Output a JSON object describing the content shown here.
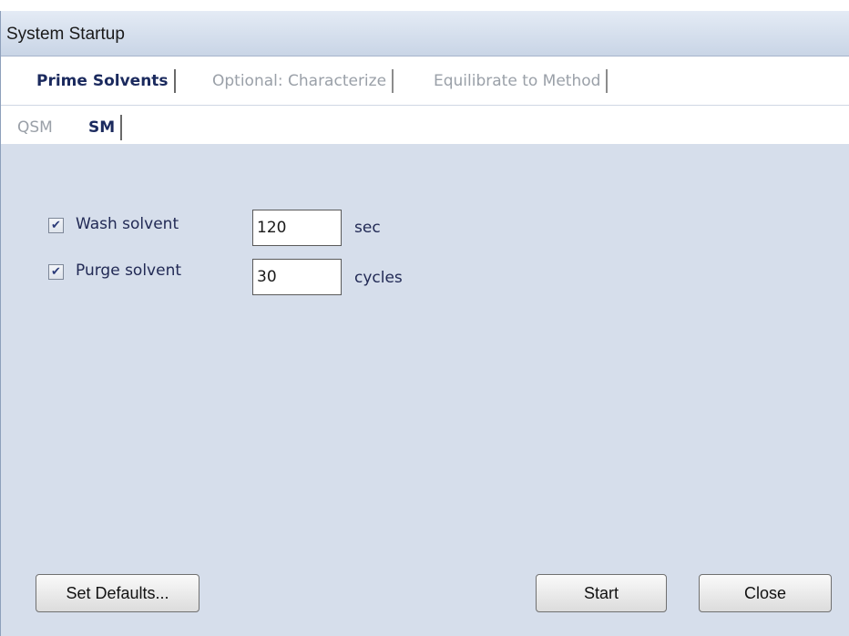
{
  "window": {
    "title": "System Startup"
  },
  "main_tabs": [
    {
      "label": "Prime Solvents",
      "active": true
    },
    {
      "label": "Optional: Characterize",
      "active": false
    },
    {
      "label": "Equilibrate to Method",
      "active": false
    }
  ],
  "sub_tabs": [
    {
      "label": "QSM",
      "active": false
    },
    {
      "label": "SM",
      "active": true
    }
  ],
  "options": {
    "wash": {
      "label": "Wash solvent",
      "checked": true,
      "value": "120",
      "unit": "sec"
    },
    "purge": {
      "label": "Purge solvent",
      "checked": true,
      "value": "30",
      "unit": "cycles"
    }
  },
  "checkmark": "✔",
  "buttons": {
    "set_defaults": "Set Defaults...",
    "start": "Start",
    "close": "Close"
  }
}
